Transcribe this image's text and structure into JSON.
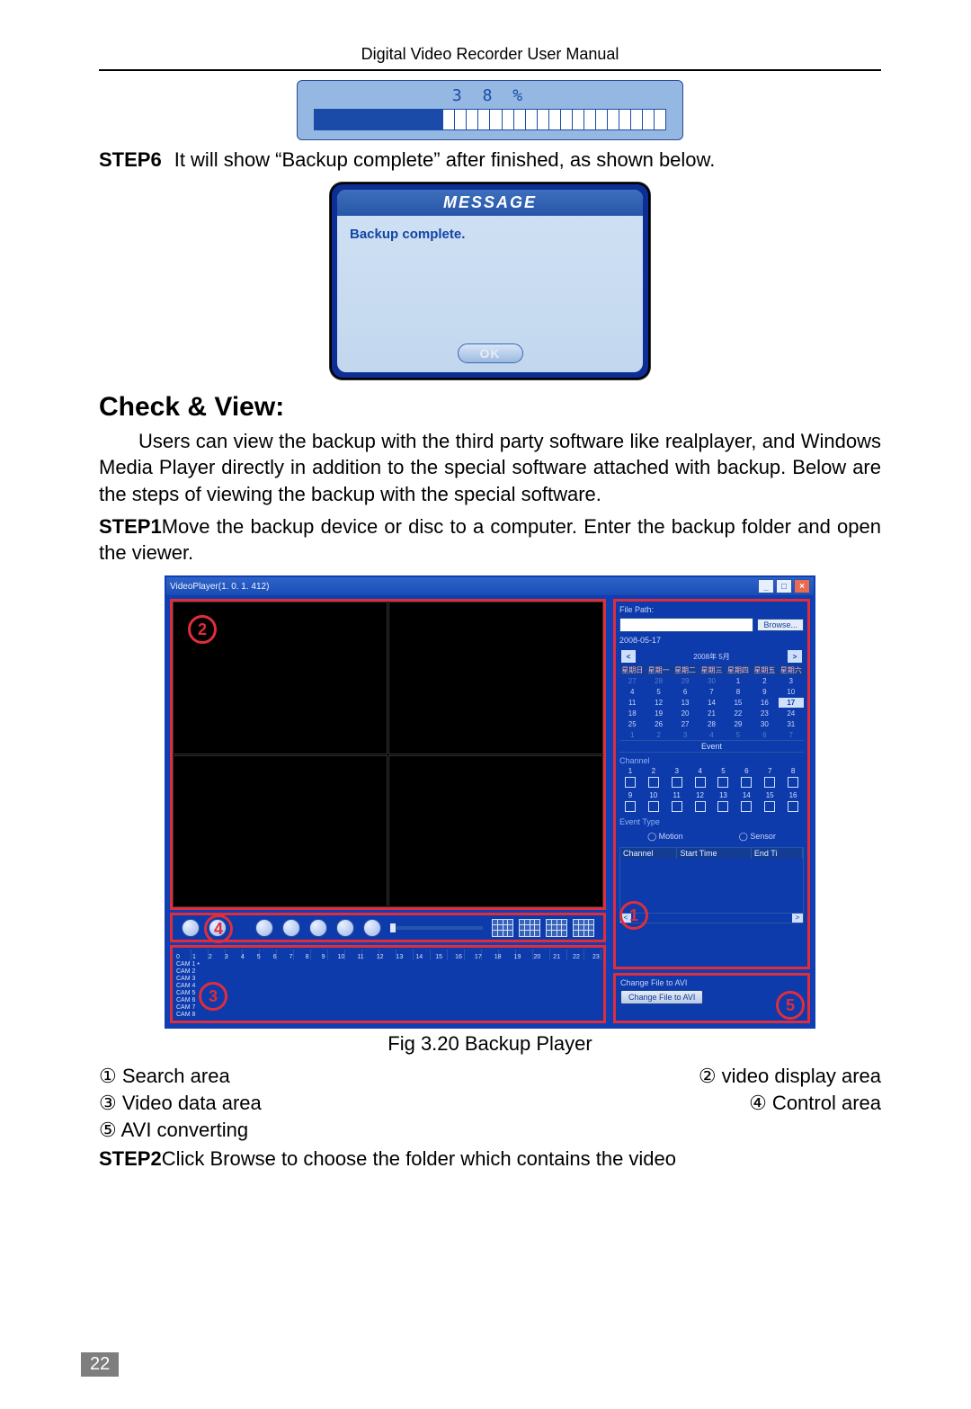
{
  "header": "Digital Video Recorder User Manual",
  "progress": {
    "pct_text": "3 8  %",
    "fill_segments": 11,
    "total_segments": 30
  },
  "step6_label": "STEP6",
  "step6_text": "It will show “Backup complete” after finished, as shown below.",
  "msg": {
    "title": "MESSAGE",
    "body": "Backup complete.",
    "ok": "OK"
  },
  "heading": "Check & View:",
  "intro": "Users can view the backup with the third party software like realplayer, and Windows Media Player directly in addition to the special software attached with backup. Below are the steps of viewing the backup with the special software.",
  "step1_label": "STEP1",
  "step1_text": "Move the backup device or disc to a computer. Enter the backup folder and open the viewer.",
  "player": {
    "title": "VideoPlayer(1. 0. 1. 412)",
    "file_path_label": "File Path:",
    "browse": "Browse...",
    "date_text": "2008-05-17",
    "cal_month": "2008年 5月",
    "dow": [
      "星期日",
      "星期一",
      "星期二",
      "星期三",
      "星期四",
      "星期五",
      "星期六"
    ],
    "cal_rows": [
      [
        "27",
        "28",
        "29",
        "30",
        "1",
        "2",
        "3"
      ],
      [
        "4",
        "5",
        "6",
        "7",
        "8",
        "9",
        "10"
      ],
      [
        "11",
        "12",
        "13",
        "14",
        "15",
        "16",
        "17"
      ],
      [
        "18",
        "19",
        "20",
        "21",
        "22",
        "23",
        "24"
      ],
      [
        "25",
        "26",
        "27",
        "28",
        "29",
        "30",
        "31"
      ],
      [
        "1",
        "2",
        "3",
        "4",
        "5",
        "6",
        "7"
      ]
    ],
    "event_bar": "Event",
    "channel_label": "Channel",
    "event_type_label": "Event Type",
    "motion": "Motion",
    "sensor": "Sensor",
    "table_headers": [
      "Channel",
      "Start Time",
      "End Ti"
    ],
    "avi_label": "Change File to AVI",
    "avi_btn": "Change File to AVI",
    "ruler_hours": [
      "0",
      "1",
      "2",
      "3",
      "4",
      "5",
      "6",
      "7",
      "8",
      "9",
      "10",
      "11",
      "12",
      "13",
      "14",
      "15",
      "16",
      "17",
      "18",
      "19",
      "20",
      "21",
      "22",
      "23"
    ],
    "cams": [
      "CAM 1",
      "CAM 2",
      "CAM 3",
      "CAM 4",
      "CAM 5",
      "CAM 6",
      "CAM 7",
      "CAM 8"
    ]
  },
  "fig_caption": "Fig 3.20 Backup Player",
  "legend": {
    "l1a": "① Search area",
    "l1b": "② video display area",
    "l2a": "③ Video data area",
    "l2b": "④ Control area",
    "l3a": "⑤ AVI converting"
  },
  "step2_label": "STEP2",
  "step2_text": "Click Browse to choose the folder which contains the video",
  "pageno": "22",
  "circ": {
    "c1": "1",
    "c2": "2",
    "c3": "3",
    "c4": "4",
    "c5": "5"
  }
}
